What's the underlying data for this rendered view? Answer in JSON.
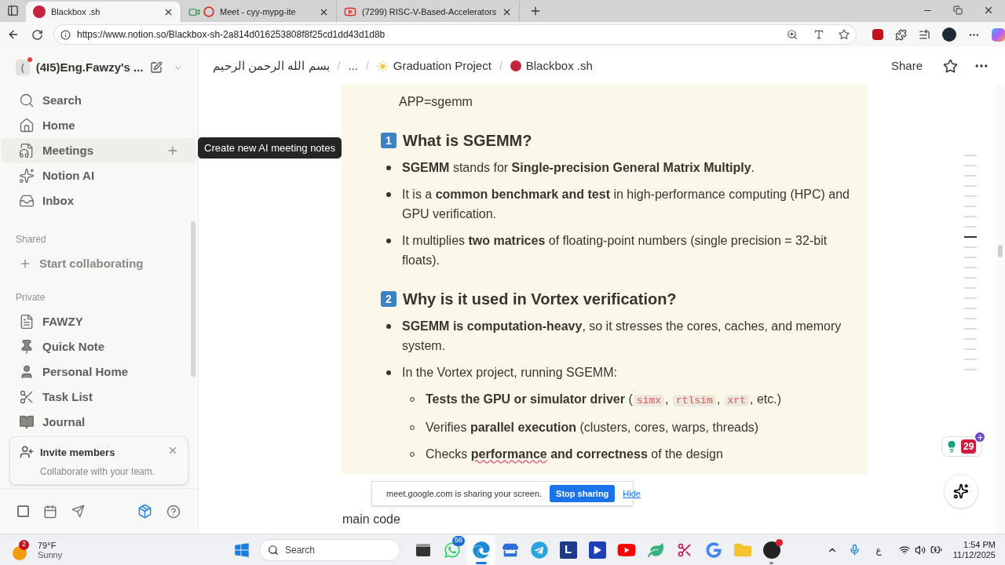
{
  "browser": {
    "tabs": [
      {
        "title": "Blackbox .sh",
        "kind": "face",
        "selected": true
      },
      {
        "title": "Meet - cyy-mypg-ite",
        "kind": "record",
        "selected": false
      },
      {
        "title": "(7299) RISC-V-Based-Accelerators",
        "kind": "video",
        "selected": false
      }
    ],
    "url": "https://www.notion.so/Blackbox-sh-2a814d016253808f8f25cd1dd43d1d8b"
  },
  "sidebar": {
    "workspace": "(4I5)Eng.Fawzy's ...",
    "workspace_initial": "(",
    "nav": [
      {
        "label": "Search",
        "kind": "search",
        "hovered": false
      },
      {
        "label": "Home",
        "kind": "home",
        "hovered": false
      },
      {
        "label": "Meetings",
        "kind": "meetings",
        "hovered": true
      },
      {
        "label": "Notion AI",
        "kind": "ai",
        "hovered": false
      },
      {
        "label": "Inbox",
        "kind": "inbox",
        "hovered": false
      }
    ],
    "tooltip": "Create new AI meeting notes",
    "shared_heading": "Shared",
    "shared_items": [
      {
        "label": "Start collaborating",
        "kind": "plus"
      }
    ],
    "private_heading": "Private",
    "private_items": [
      {
        "label": "FAWZY",
        "kind": "page"
      },
      {
        "label": "Quick Note",
        "kind": "pin"
      },
      {
        "label": "Personal Home",
        "kind": "person"
      },
      {
        "label": "Task List",
        "kind": "scissors"
      },
      {
        "label": "Journal",
        "kind": "book"
      }
    ],
    "invite": {
      "title": "Invite members",
      "subtitle": "Collaborate with your team."
    }
  },
  "topbar": {
    "breadcrumbs": [
      {
        "label": "بسم الله الرحمن الرحيم",
        "kind": "page"
      },
      {
        "label": "/",
        "kind": "separator"
      },
      {
        "label": "...",
        "kind": "page"
      },
      {
        "label": "/",
        "kind": "separator"
      },
      {
        "label": "Graduation Project",
        "kind": "sun"
      },
      {
        "label": "/",
        "kind": "separator"
      },
      {
        "label": "Blackbox .sh",
        "kind": "face"
      }
    ],
    "share": "Share"
  },
  "callout": {
    "blocks": [
      {
        "kind": "text",
        "segments": [
          {
            "kind": "plain",
            "text": "APP=sgemm"
          }
        ]
      },
      {
        "kind": "heading",
        "number": "1",
        "segments": [
          {
            "kind": "plain",
            "text": "What is SGEMM?"
          }
        ]
      },
      {
        "kind": "bullet",
        "segments": [
          {
            "kind": "bold",
            "text": "SGEMM"
          },
          {
            "kind": "plain",
            "text": " stands for "
          },
          {
            "kind": "bold",
            "text": "Single-precision General Matrix Multiply"
          },
          {
            "kind": "plain",
            "text": "."
          }
        ]
      },
      {
        "kind": "bullet",
        "segments": [
          {
            "kind": "plain",
            "text": "It is a "
          },
          {
            "kind": "bold",
            "text": "common benchmark and test"
          },
          {
            "kind": "plain",
            "text": " in high-performance computing (HPC) and GPU verification."
          }
        ]
      },
      {
        "kind": "bullet",
        "segments": [
          {
            "kind": "plain",
            "text": "It multiplies "
          },
          {
            "kind": "bold",
            "text": "two matrices"
          },
          {
            "kind": "plain",
            "text": " of floating-point numbers (single precision = 32-bit floats)."
          }
        ]
      },
      {
        "kind": "heading",
        "number": "2",
        "segments": [
          {
            "kind": "plain",
            "text": "Why is it used in Vortex verification?"
          }
        ]
      },
      {
        "kind": "bullet",
        "segments": [
          {
            "kind": "bold",
            "text": "SGEMM is computation-heavy"
          },
          {
            "kind": "plain",
            "text": ", so it stresses the cores, caches, and memory system."
          }
        ]
      },
      {
        "kind": "bullet",
        "segments": [
          {
            "kind": "plain",
            "text": "In the Vortex project, running SGEMM:"
          }
        ],
        "children": [
          {
            "kind": "bullet",
            "segments": [
              {
                "kind": "bold",
                "text": "Tests the GPU or simulator driver"
              },
              {
                "kind": "plain",
                "text": " ("
              },
              {
                "kind": "code",
                "text": "simx"
              },
              {
                "kind": "plain",
                "text": ", "
              },
              {
                "kind": "code",
                "text": "rtlsim"
              },
              {
                "kind": "plain",
                "text": ", "
              },
              {
                "kind": "code",
                "text": "xrt"
              },
              {
                "kind": "plain",
                "text": ", etc.)"
              }
            ]
          },
          {
            "kind": "bullet",
            "segments": [
              {
                "kind": "plain",
                "text": "Verifies "
              },
              {
                "kind": "bold",
                "text": "parallel execution"
              },
              {
                "kind": "plain",
                "text": " (clusters, cores, warps, threads)"
              }
            ]
          },
          {
            "kind": "bullet",
            "segments": [
              {
                "kind": "plain",
                "text": "Checks "
              },
              {
                "kind": "flagged",
                "text": "performance"
              },
              {
                "kind": "bold",
                "text": " and correctness"
              },
              {
                "kind": "plain",
                "text": " of the design"
              }
            ]
          }
        ]
      }
    ]
  },
  "after_callout": "main code",
  "toc": [
    {
      "selected": false
    },
    {
      "selected": false
    },
    {
      "selected": false
    },
    {
      "selected": false
    },
    {
      "selected": false
    },
    {
      "selected": false
    },
    {
      "selected": false
    },
    {
      "selected": false
    },
    {
      "selected": true
    },
    {
      "selected": false
    },
    {
      "selected": false
    },
    {
      "selected": false
    },
    {
      "selected": false
    },
    {
      "selected": false
    },
    {
      "selected": false
    },
    {
      "selected": false
    },
    {
      "selected": false
    },
    {
      "selected": false
    },
    {
      "selected": false
    },
    {
      "selected": false
    },
    {
      "selected": false
    },
    {
      "selected": false
    }
  ],
  "widget_badge": "29",
  "share_bar": {
    "message": "meet.google.com is sharing your screen.",
    "stop": "Stop sharing",
    "hide": "Hide"
  },
  "taskbar": {
    "weather": {
      "badge": "2",
      "temp": "79°F",
      "condition": "Sunny"
    },
    "search": "Search",
    "apps": [
      {
        "kind": "files",
        "focused": false,
        "running": false
      },
      {
        "kind": "whatsapp",
        "badge": "56",
        "focused": false,
        "running": false
      },
      {
        "kind": "edge",
        "focused": true,
        "running": true
      },
      {
        "kind": "store",
        "focused": false,
        "running": false
      },
      {
        "kind": "telegram",
        "focused": false,
        "running": false
      },
      {
        "kind": "letter",
        "letter": "L",
        "focused": false,
        "running": false
      },
      {
        "kind": "player",
        "focused": false,
        "running": false
      },
      {
        "kind": "youtube",
        "focused": false,
        "running": false
      },
      {
        "kind": "leaf",
        "focused": false,
        "running": false
      },
      {
        "kind": "snip",
        "focused": false,
        "running": false
      },
      {
        "kind": "google",
        "focused": false,
        "running": false
      },
      {
        "kind": "folder",
        "focused": false,
        "running": false
      },
      {
        "kind": "obs",
        "focused": false,
        "running": true
      }
    ],
    "language": "ع",
    "time": "1:54 PM",
    "date": "11/12/2025"
  }
}
